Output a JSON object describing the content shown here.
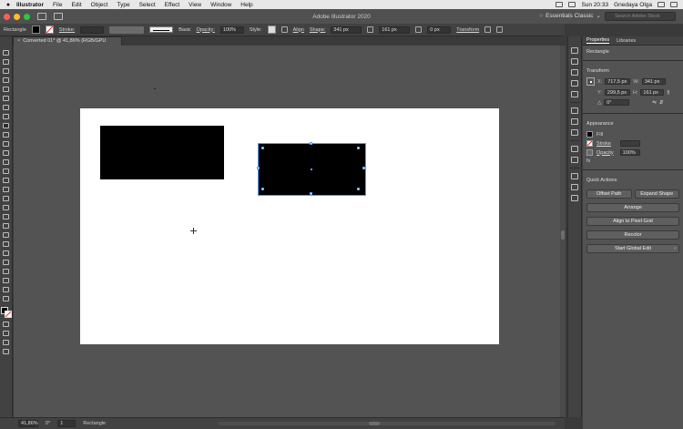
{
  "menubar": {
    "app": "Illustrator",
    "items": [
      "File",
      "Edit",
      "Object",
      "Type",
      "Select",
      "Effect",
      "View",
      "Window",
      "Help"
    ],
    "clock": "Sun 20:33",
    "user": "Gnedaya Olga"
  },
  "titlebar": {
    "title": "Adobe Illustrator 2020",
    "workspace": "Essentials Classic",
    "search_placeholder": "Search Adobe Stock"
  },
  "controlbar": {
    "object_type": "Rectangle",
    "stroke_label": "Stroke:",
    "brush_label": "Basic",
    "opacity_label": "Opacity:",
    "opacity_value": "100%",
    "style_label": "Style:",
    "align_label": "Align",
    "shape_label": "Shape:",
    "width_value": "341 px",
    "height_value": "161 px",
    "corner_value": "0 px",
    "transform_label": "Transform"
  },
  "document": {
    "tab_label": "Converted 01* @ 41,86% (RGB/GPU Preview)"
  },
  "statusbar": {
    "zoom": "41,86%",
    "angle": "0°",
    "artboard": "1",
    "tool": "Rectangle"
  },
  "panel": {
    "tabs": [
      "Properties",
      "Libraries"
    ],
    "subtitle": "Rectangle",
    "transform": {
      "title": "Transform",
      "x_label": "X:",
      "x_value": "717,5 px",
      "y_label": "Y:",
      "y_value": "299,5 px",
      "w_label": "W:",
      "w_value": "341 px",
      "h_label": "H:",
      "h_value": "161 px",
      "angle_value": "0°"
    },
    "appearance": {
      "title": "Appearance",
      "fill_label": "Fill",
      "stroke_label": "Stroke",
      "opacity_label": "Opacity",
      "opacity_value": "100%",
      "fx_label": "fx"
    },
    "quick_actions": {
      "title": "Quick Actions",
      "offset_path": "Offset Path",
      "expand_shape": "Expand Shape",
      "arrange": "Arrange",
      "align_pixel_grid": "Align to Pixel Grid",
      "recolor": "Recolor",
      "start_global_edit": "Start Global Edit"
    }
  },
  "colors": {
    "fill": "#000000",
    "selection": "#5b9bf0",
    "artboard": "#ffffff",
    "canvas": "#535353"
  }
}
